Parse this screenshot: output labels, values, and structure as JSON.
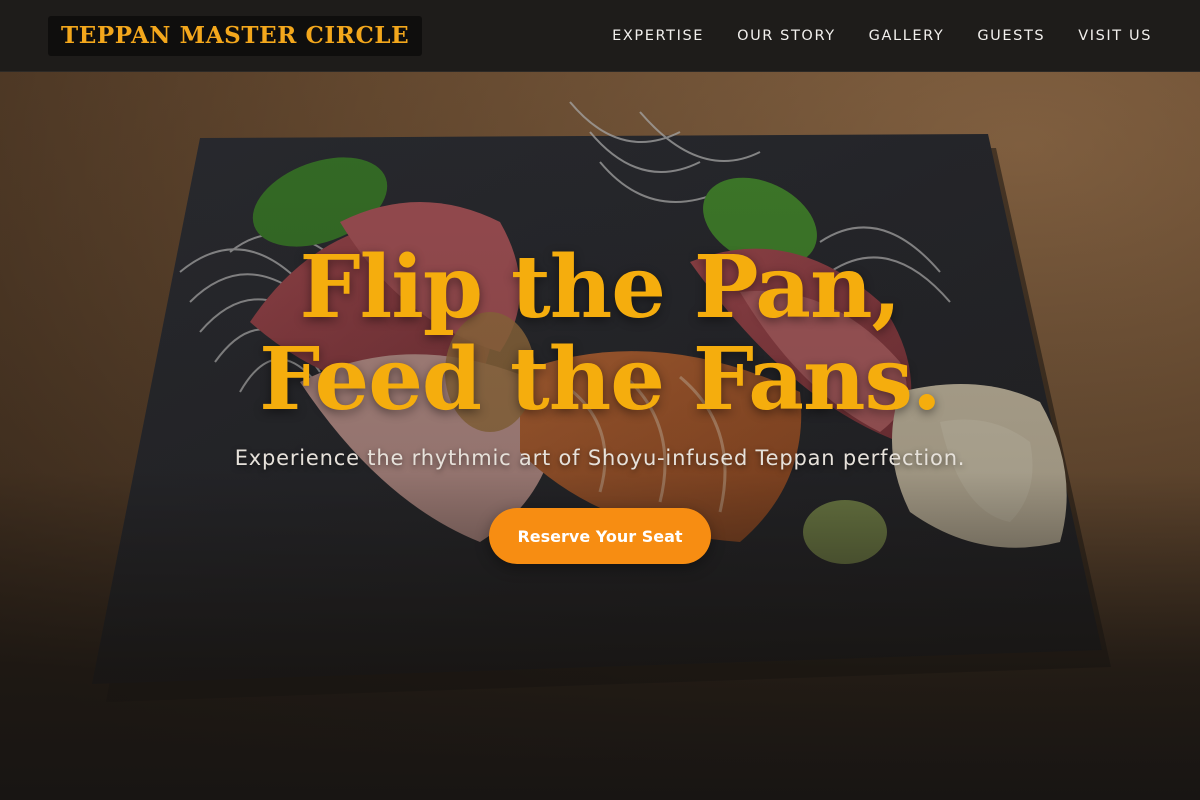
{
  "header": {
    "logo_text": "TEPPAN MASTER CIRCLE",
    "nav": [
      {
        "label": "EXPERTISE"
      },
      {
        "label": "OUR STORY"
      },
      {
        "label": "GALLERY"
      },
      {
        "label": "GUESTS"
      },
      {
        "label": "VISIT US"
      }
    ]
  },
  "hero": {
    "title_line_1": "Flip the Pan,",
    "title_line_2": "Feed the Fans.",
    "subtitle": "Experience the rhythmic art of Shoyu-infused Teppan perfection.",
    "cta_label": "Reserve Your Seat",
    "background_image": "sashimi-platter-photo"
  },
  "colors": {
    "accent": "#f5ad0d",
    "button": "#f78d12",
    "header_bg": "#1e1c1a",
    "logo_bg": "#0f0e0d"
  }
}
